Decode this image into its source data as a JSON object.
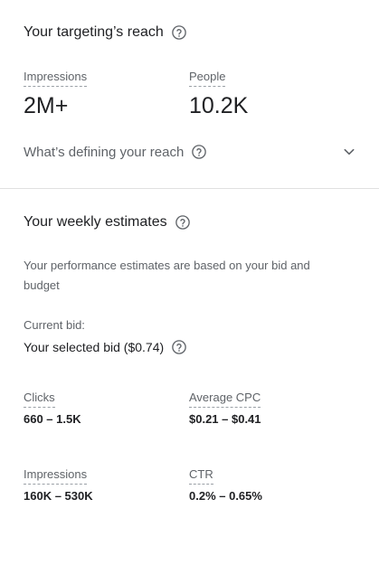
{
  "reach": {
    "title": "Your targeting’s reach",
    "metrics": [
      {
        "label": "Impressions",
        "value": "2M+"
      },
      {
        "label": "People",
        "value": "10.2K"
      }
    ],
    "defining_label": "What’s defining your reach",
    "icons": {
      "help": "help-circle-icon",
      "expand": "chevron-down-icon"
    }
  },
  "estimates": {
    "title": "Your weekly estimates",
    "description": "Your performance estimates are based on your bid and budget",
    "bid_label": "Current bid:",
    "bid_value": "Your selected bid ($0.74)",
    "metrics": [
      {
        "label": "Clicks",
        "value": "660 – 1.5K"
      },
      {
        "label": "Average CPC",
        "value": "$0.21 – $0.41"
      },
      {
        "label": "Impressions",
        "value": "160K – 530K"
      },
      {
        "label": "CTR",
        "value": "0.2% – 0.65%"
      }
    ]
  },
  "colors": {
    "text_primary": "#202124",
    "text_secondary": "#5f6368",
    "divider": "#e0e0e0"
  }
}
